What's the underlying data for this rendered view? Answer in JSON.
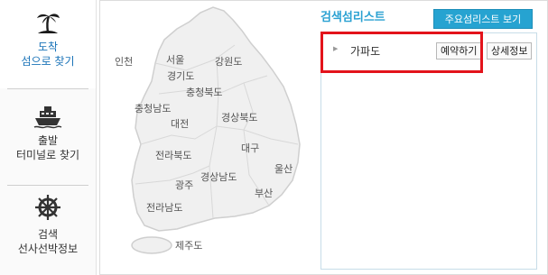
{
  "sidebar": {
    "items": [
      {
        "label_line1": "도착",
        "label_line2": "섬으로 찾기",
        "icon": "island-icon",
        "active": true
      },
      {
        "label_line1": "출발",
        "label_line2": "터미널로 찾기",
        "icon": "ship-icon",
        "active": false
      },
      {
        "label_line1": "검색",
        "label_line2": "선사선박정보",
        "icon": "ship-wheel-icon",
        "active": false
      }
    ]
  },
  "map": {
    "regions": {
      "incheon": "인천",
      "seoul": "서울",
      "gyeonggi": "경기도",
      "gangwon": "강원도",
      "chungbuk": "충청북도",
      "chungnam": "충청남도",
      "daejeon": "대전",
      "gyeongbuk": "경상북도",
      "daegu": "대구",
      "jeonbuk": "전라북도",
      "ulsan": "울산",
      "gwangju": "광주",
      "gyeongnam": "경상남도",
      "busan": "부산",
      "jeonnam": "전라남도",
      "jeju": "제주도"
    }
  },
  "panel": {
    "title": "검색섬리스트",
    "major_button": "주요섬리스트 보기",
    "results": [
      {
        "name": "가파도",
        "reserve_label": "예약하기",
        "detail_label": "상세정보"
      }
    ]
  },
  "colors": {
    "accent": "#26a3d1",
    "active_text": "#1a73b8",
    "highlight": "#e3131b",
    "map_fill": "#f0f0f0"
  }
}
